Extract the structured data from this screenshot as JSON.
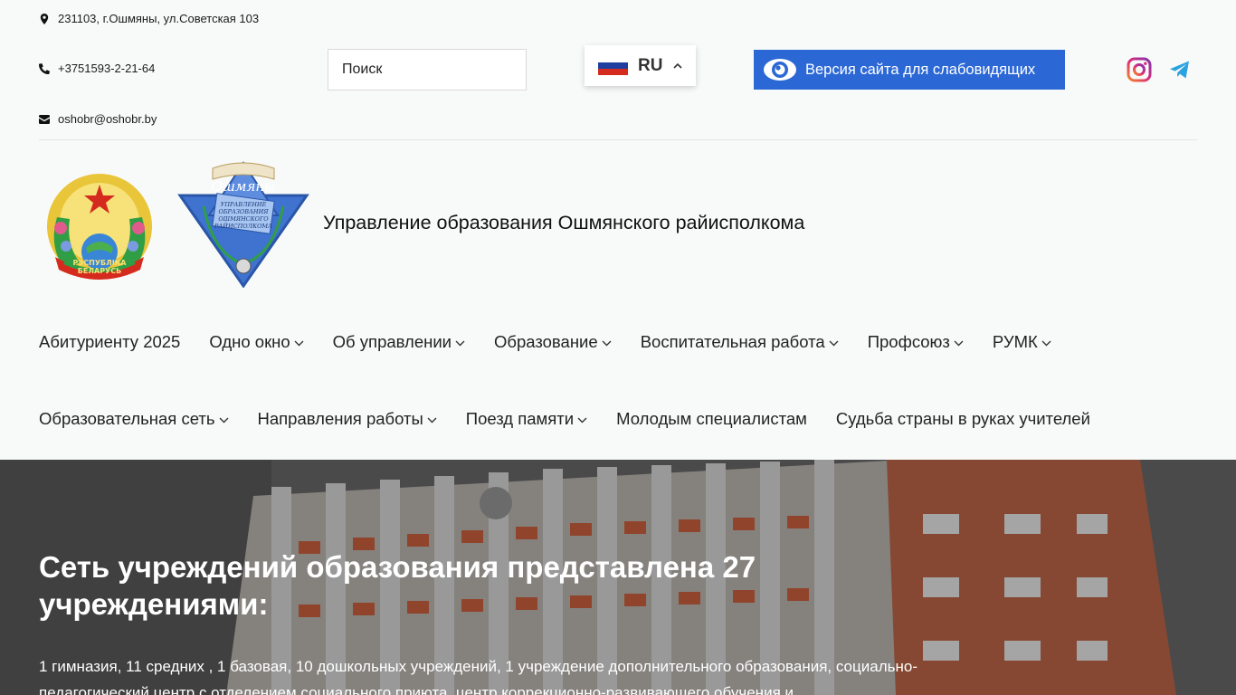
{
  "contacts": {
    "address": "231103, г.Ошмяны, ул.Советская 103",
    "phone": "+3751593-2-21-64",
    "email": "oshobr@oshobr.by"
  },
  "search": {
    "placeholder": "Поиск"
  },
  "language": {
    "code": "RU",
    "flag_colors": [
      "#ffffff",
      "#1f3fa0",
      "#d52b1e"
    ]
  },
  "accessibility_button": {
    "label": "Версия сайта для слабовидящих",
    "color": "#2b68d6"
  },
  "social": {
    "icons": [
      "instagram-icon",
      "telegram-icon"
    ]
  },
  "header": {
    "org_name": "Управление образования Ошмянского райисполкома"
  },
  "emblem": {
    "ribbon_text": "РЭСПУБЛІКА БЕЛАРУСЬ"
  },
  "logo": {
    "title": "Ошмяны",
    "text": "УПРАВЛЕНИЕ ОБРАЗОВАНИЯ ОШМЯНСКОГО РАЙИСПОЛКОМА"
  },
  "nav": {
    "row1": [
      {
        "label": "Абитуриенту 2025",
        "dropdown": false
      },
      {
        "label": "Одно окно",
        "dropdown": true
      },
      {
        "label": "Об управлении",
        "dropdown": true
      },
      {
        "label": "Образование",
        "dropdown": true
      },
      {
        "label": "Воспитательная работа",
        "dropdown": true
      },
      {
        "label": "Профсоюз",
        "dropdown": true
      },
      {
        "label": "РУМК",
        "dropdown": true
      }
    ],
    "row2": [
      {
        "label": "Образовательная сеть",
        "dropdown": true
      },
      {
        "label": "Направления работы",
        "dropdown": true
      },
      {
        "label": "Поезд памяти",
        "dropdown": true
      },
      {
        "label": "Молодым специалистам",
        "dropdown": false
      },
      {
        "label": "Судьба страны в руках учителей",
        "dropdown": false
      }
    ]
  },
  "hero": {
    "title": "Сеть учреждений образования представлена 27 учреждениями:",
    "text": "1 гимназия, 11 средних , 1 базовая, 10 дошкольных учреждений, 1 учреждение дополнительного образования, социально-педагогический центр с отделением социального приюта, центр коррекционно-развивающего обучения и"
  }
}
